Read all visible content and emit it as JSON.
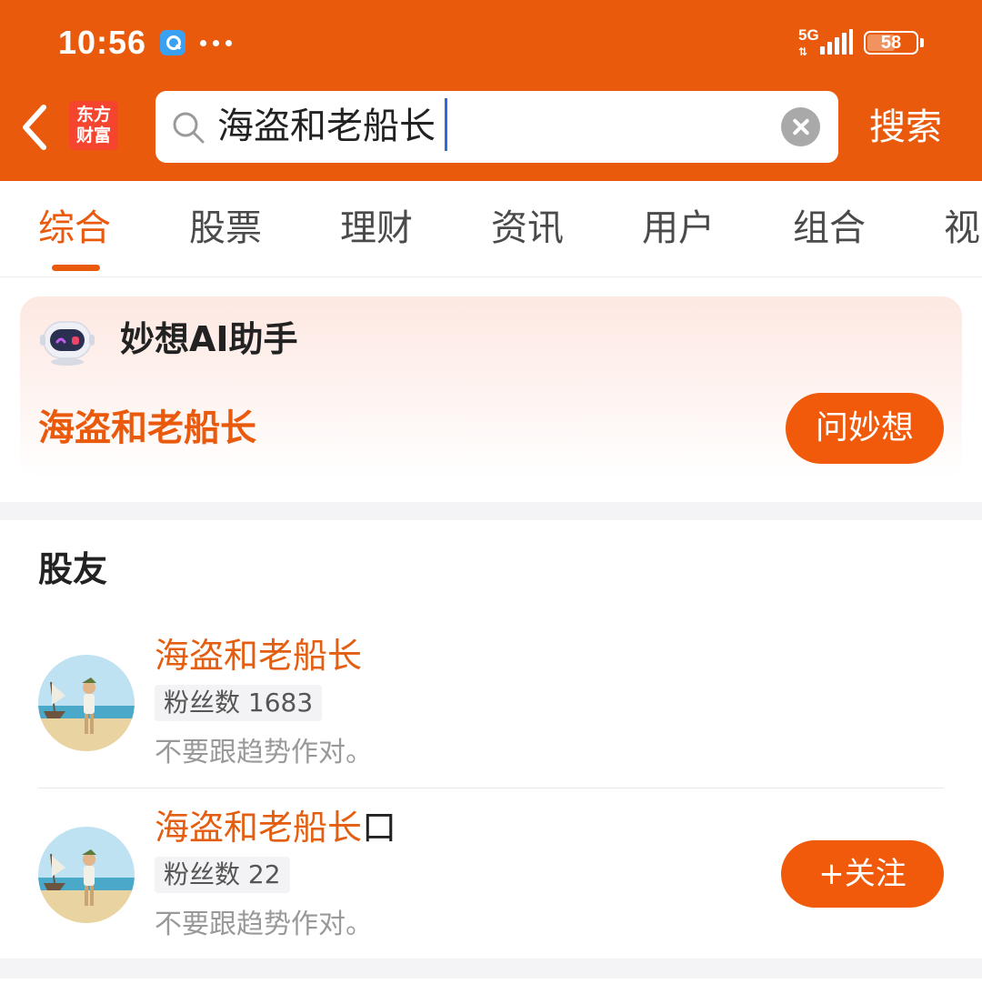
{
  "status_bar": {
    "time": "10:56",
    "network": "5G",
    "battery": "58",
    "battery_level": 0.58
  },
  "header": {
    "logo_line1": "东方",
    "logo_line2": "财富",
    "search_value": "海盗和老船长",
    "search_button": "搜索"
  },
  "tabs": [
    {
      "label": "综合",
      "active": true
    },
    {
      "label": "股票",
      "active": false
    },
    {
      "label": "理财",
      "active": false
    },
    {
      "label": "资讯",
      "active": false
    },
    {
      "label": "用户",
      "active": false
    },
    {
      "label": "组合",
      "active": false
    },
    {
      "label": "视",
      "active": false
    }
  ],
  "ai_card": {
    "title": "妙想AI助手",
    "query": "海盗和老船长",
    "ask_button": "问妙想"
  },
  "friends": {
    "section_title": "股友",
    "users": [
      {
        "name": "海盗和老船长",
        "suffix": "",
        "fans": "粉丝数 1683",
        "desc": "不要跟趋势作对。"
      },
      {
        "name": "海盗和老船长",
        "suffix": "口",
        "fans": "粉丝数 22",
        "desc": "不要跟趋势作对。",
        "follow_label": "+关注"
      }
    ]
  },
  "colors": {
    "brand": "#e95a0c",
    "button": "#f05a0a",
    "logo": "#f6452e"
  }
}
